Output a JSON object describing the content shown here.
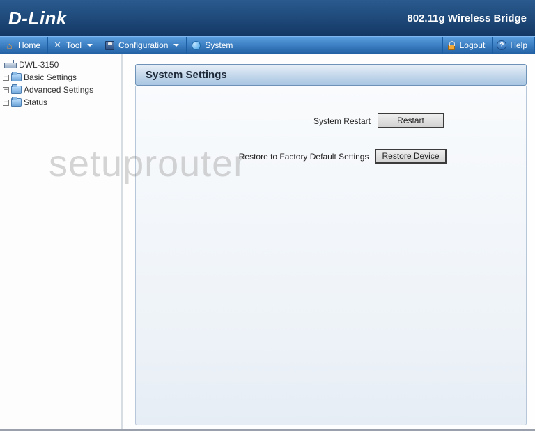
{
  "header": {
    "logo_text": "D-Link",
    "product_title": "802.11g Wireless Bridge"
  },
  "toolbar": {
    "home": "Home",
    "tool": "Tool",
    "configuration": "Configuration",
    "system": "System",
    "logout": "Logout",
    "help": "Help"
  },
  "sidebar": {
    "device": "DWL-3150",
    "items": [
      {
        "label": "Basic Settings"
      },
      {
        "label": "Advanced Settings"
      },
      {
        "label": "Status"
      }
    ],
    "expander_glyph": "+"
  },
  "panel": {
    "title": "System Settings",
    "rows": [
      {
        "label": "System Restart",
        "button": "Restart"
      },
      {
        "label": "Restore to Factory Default Settings",
        "button": "Restore Device"
      }
    ]
  },
  "watermark": "setuprouter",
  "icons": {
    "help_glyph": "?"
  }
}
